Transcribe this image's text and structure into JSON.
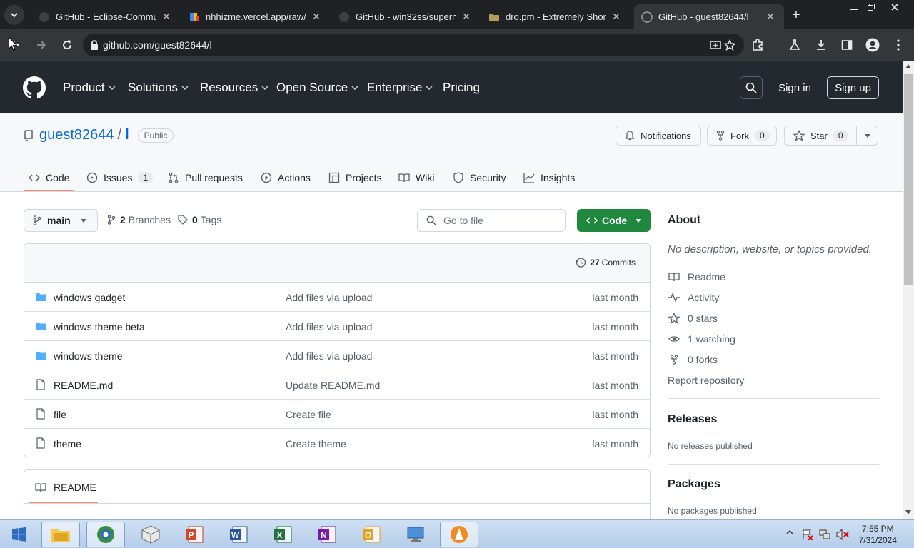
{
  "browser": {
    "tabs": [
      {
        "title": "GitHub - Eclipse-Commun",
        "favicon": "github-icon"
      },
      {
        "title": "nhhizme.vercel.app/raw/l",
        "favicon": "colorful-icon"
      },
      {
        "title": "GitHub - win32ss/superm",
        "favicon": "github-icon"
      },
      {
        "title": "dro.pm - Extremely Short",
        "favicon": "folder-icon"
      },
      {
        "title": "GitHub - guest82644/l",
        "favicon": "github-icon",
        "active": true
      }
    ],
    "url": "github.com/guest82644/l"
  },
  "gh_header": {
    "nav": [
      "Product",
      "Solutions",
      "Resources",
      "Open Source",
      "Enterprise",
      "Pricing"
    ],
    "signin": "Sign in",
    "signup": "Sign up"
  },
  "repo": {
    "owner": "guest82644",
    "separator": "/",
    "name": "l",
    "visibility": "Public",
    "notifications": "Notifications",
    "fork_label": "Fork",
    "fork_count": "0",
    "star_label": "Star",
    "star_count": "0"
  },
  "repo_nav": {
    "code": "Code",
    "issues": "Issues",
    "issues_count": "1",
    "pulls": "Pull requests",
    "actions": "Actions",
    "projects": "Projects",
    "wiki": "Wiki",
    "security": "Security",
    "insights": "Insights"
  },
  "main": {
    "branch": "main",
    "branches_count": "2",
    "branches_label": "Branches",
    "tags_count": "0",
    "tags_label": "Tags",
    "goto_placeholder": "Go to file",
    "code_button": "Code",
    "commits_count": "27",
    "commits_label": "Commits",
    "files": [
      {
        "name": "windows gadget",
        "type": "folder",
        "message": "Add files via upload",
        "date": "last month"
      },
      {
        "name": "windows theme beta",
        "type": "folder",
        "message": "Add files via upload",
        "date": "last month"
      },
      {
        "name": "windows theme",
        "type": "folder",
        "message": "Add files via upload",
        "date": "last month"
      },
      {
        "name": "README.md",
        "type": "file",
        "message": "Update README.md",
        "date": "last month"
      },
      {
        "name": "file",
        "type": "file",
        "message": "Create file",
        "date": "last month"
      },
      {
        "name": "theme",
        "type": "file",
        "message": "Create theme",
        "date": "last month"
      }
    ],
    "readme_label": "README"
  },
  "sidebar": {
    "about_title": "About",
    "about_desc": "No description, website, or topics provided.",
    "readme": "Readme",
    "activity": "Activity",
    "stars": "0 stars",
    "watching": "1 watching",
    "forks": "0 forks",
    "report": "Report repository",
    "releases_title": "Releases",
    "releases_text": "No releases published",
    "packages_title": "Packages",
    "packages_text": "No packages published"
  },
  "taskbar": {
    "time": "7:55 PM",
    "date": "7/31/2024"
  },
  "colors": {
    "github_header": "#24292f",
    "link": "#0969da",
    "green_button": "#1f883d",
    "tab_underline": "#fd8c73",
    "folder": "#54aeff"
  }
}
